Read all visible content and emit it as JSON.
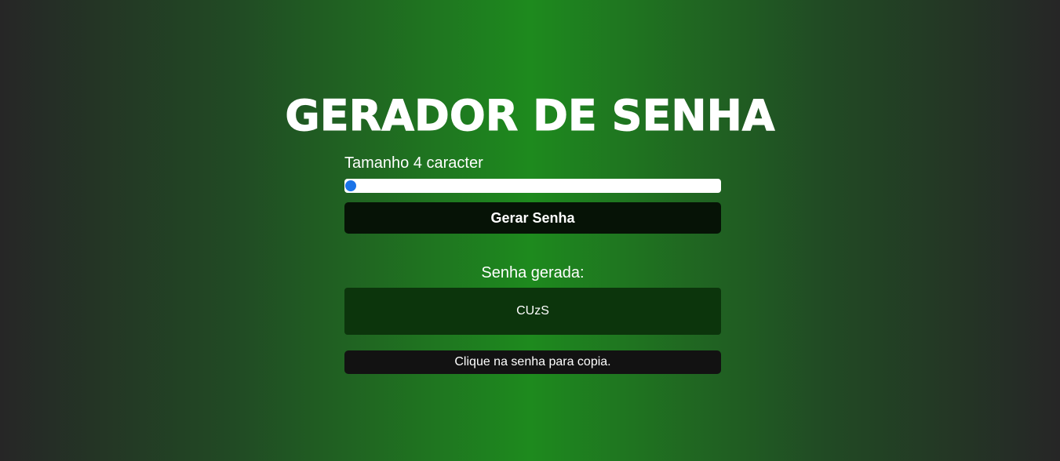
{
  "header": {
    "title": "GERADOR DE SENHA"
  },
  "controls": {
    "length_label": "Tamanho 4 caracter",
    "slider_value_fraction": 0.0,
    "generate_button_label": "Gerar Senha"
  },
  "result": {
    "label": "Senha gerada:",
    "password": "CUzS",
    "tooltip": "Clique na senha para copia."
  },
  "colors": {
    "background_center": "#1e8a1e",
    "background_edge": "#262626",
    "button_bg": "#061306",
    "password_bg": "#0c350c",
    "tooltip_bg": "#121212",
    "slider_thumb": "#1a73e8"
  }
}
